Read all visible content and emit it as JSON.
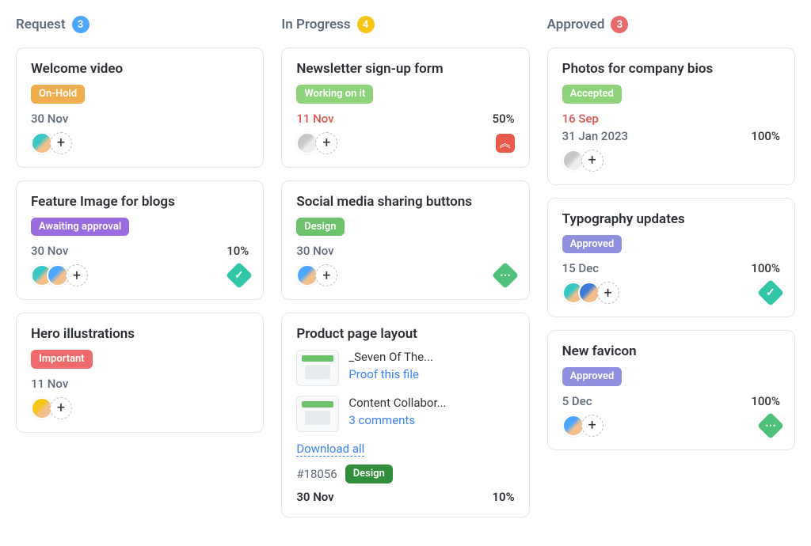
{
  "columns": [
    {
      "title": "Request",
      "count": "3",
      "count_color": "count-blue",
      "cards": [
        {
          "title": "Welcome video",
          "tag": "On-Hold",
          "tag_class": "tag-onhold",
          "date1": "30 Nov",
          "date1_class": "date-norm",
          "date2": "",
          "percent": "",
          "avatars": [
            "av-teal"
          ],
          "priority": ""
        },
        {
          "title": "Feature Image for blogs",
          "tag": "Awaiting approval",
          "tag_class": "tag-awaiting",
          "date1": "30 Nov",
          "date1_class": "date-norm",
          "date2": "",
          "percent": "10%",
          "avatars": [
            "av-teal",
            "av-blue"
          ],
          "priority": "teal-check"
        },
        {
          "title": "Hero illustrations",
          "tag": "Important",
          "tag_class": "tag-important",
          "date1": "11 Nov",
          "date1_class": "date-norm",
          "date2": "",
          "percent": "",
          "avatars": [
            "av-yellow"
          ],
          "priority": ""
        }
      ]
    },
    {
      "title": "In Progress",
      "count": "4",
      "count_color": "count-yellow",
      "cards": [
        {
          "title": "Newsletter sign-up form",
          "tag": "Working on it",
          "tag_class": "tag-working",
          "date1": "11 Nov",
          "date1_class": "date-due",
          "date2": "",
          "percent": "50%",
          "avatars": [
            "av-gray"
          ],
          "priority": "red-up"
        },
        {
          "title": "Social media sharing buttons",
          "tag": "Design",
          "tag_class": "tag-design",
          "date1": "30 Nov",
          "date1_class": "date-norm",
          "date2": "",
          "percent": "",
          "avatars": [
            "av-blue"
          ],
          "priority": "green-dots"
        }
      ],
      "product_card": {
        "title": "Product page layout",
        "files": [
          {
            "name": "_Seven Of The...",
            "link": "Proof this file"
          },
          {
            "name": "Content Collabor...",
            "link": "3 comments"
          }
        ],
        "download_all": "Download all",
        "ref": "#18056",
        "ref_tag": "Design",
        "bottom_date": "30 Nov",
        "bottom_percent": "10%"
      }
    },
    {
      "title": "Approved",
      "count": "3",
      "count_color": "count-red",
      "cards": [
        {
          "title": "Photos for company bios",
          "tag": "Accepted",
          "tag_class": "tag-accepted",
          "date1": "16 Sep",
          "date1_class": "date-due",
          "date2": "31 Jan 2023",
          "percent": "100%",
          "avatars": [
            "av-gray"
          ],
          "priority": ""
        },
        {
          "title": "Typography updates",
          "tag": "Approved",
          "tag_class": "tag-approved",
          "date1": "15 Dec",
          "date1_class": "date-norm",
          "date2": "",
          "percent": "100%",
          "avatars": [
            "av-teal",
            "av-bluealt"
          ],
          "priority": "teal-check"
        },
        {
          "title": "New favicon",
          "tag": "Approved",
          "tag_class": "tag-approved",
          "date1": "5 Dec",
          "date1_class": "date-norm",
          "date2": "",
          "percent": "100%",
          "avatars": [
            "av-blue"
          ],
          "priority": "green-dots"
        }
      ]
    }
  ]
}
